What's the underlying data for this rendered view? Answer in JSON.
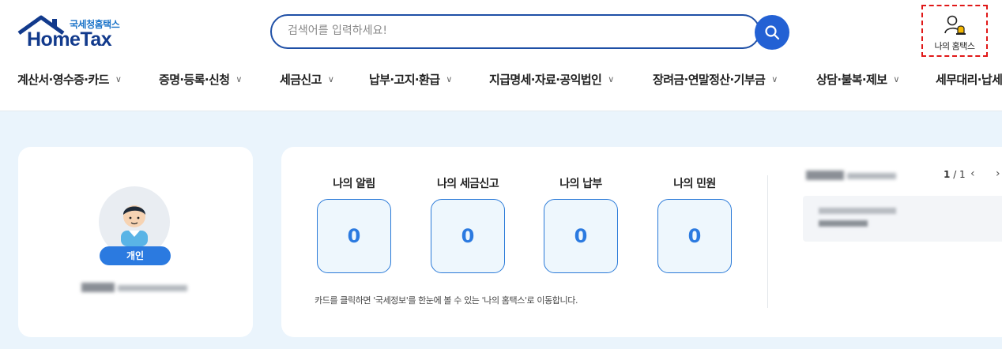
{
  "header": {
    "logo_sub": "국세청홈택스",
    "logo_main": "HomeTax",
    "search_placeholder": "검색어를 입력하세요!",
    "my_hometax_label": "나의 홈택스"
  },
  "nav": {
    "items": [
      {
        "label": "계산서·영수증·카드"
      },
      {
        "label": "증명·등록·신청"
      },
      {
        "label": "세금신고"
      },
      {
        "label": "납부·고지·환급"
      },
      {
        "label": "지급명세·자료·공익법인"
      },
      {
        "label": "장려금·연말정산·기부금"
      },
      {
        "label": "상담·불복·제보"
      },
      {
        "label": "세무대리·납세관리"
      }
    ]
  },
  "profile": {
    "badge": "개인"
  },
  "summary": {
    "tiles": [
      {
        "title": "나의 알림",
        "count": "0"
      },
      {
        "title": "나의 세금신고",
        "count": "0"
      },
      {
        "title": "나의 납부",
        "count": "0"
      },
      {
        "title": "나의 민원",
        "count": "0"
      }
    ],
    "hint": "카드를 클릭하면 '국세정보'를 한눈에 볼 수 있는 '나의 홈택스'로 이동합니다."
  },
  "notice": {
    "page_current": "1",
    "page_total": "/ 1"
  },
  "colors": {
    "brand": "#123a8c",
    "accent": "#2361d4",
    "tile_border": "#2a7ad8",
    "background": "#eaf4fc"
  }
}
